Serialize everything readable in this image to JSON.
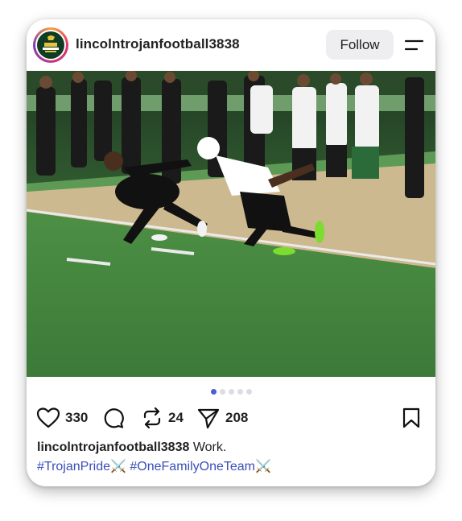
{
  "post": {
    "username": "lincolntrojanfootball3838",
    "follow_label": "Follow",
    "avatar_icon": "trojan-football-logo",
    "photo_subject": "football-players-sprinting-on-field",
    "carousel": {
      "count": 5,
      "active_index": 0
    },
    "actions": {
      "likes": "330",
      "reposts": "24",
      "shares": "208"
    },
    "caption": {
      "username": "lincolntrojanfootball3838",
      "text": "Work."
    },
    "hashtags": [
      {
        "text": "#TrojanPride",
        "emoji": "⚔️"
      },
      {
        "text": "#OneFamilyOneTeam",
        "emoji": "⚔️"
      }
    ],
    "colors": {
      "accent": "#3a4fb7",
      "dot_active": "#4b5dd6",
      "follow_bg": "#eeeef1"
    }
  }
}
